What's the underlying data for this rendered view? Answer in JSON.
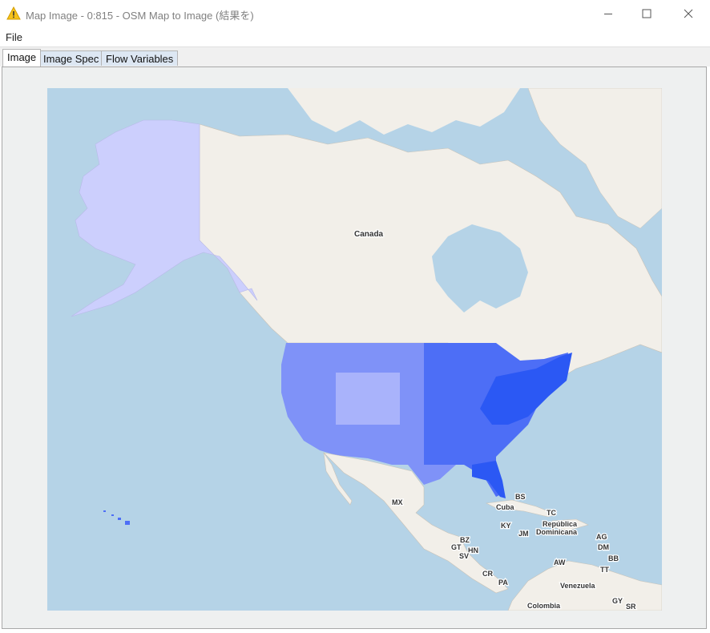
{
  "window": {
    "title": "Map Image - 0:815 - OSM Map to Image (結果を)",
    "icon": "warning-triangle-icon",
    "controls": [
      "minimize-icon",
      "maximize-icon",
      "close-icon"
    ]
  },
  "menu": {
    "items": [
      "File"
    ]
  },
  "tabs": [
    {
      "label": "Image",
      "active": true
    },
    {
      "label": "Image Spec",
      "active": false
    },
    {
      "label": "Flow Variables",
      "active": false
    }
  ],
  "map": {
    "labels": {
      "canada": "Canada",
      "mx": "MX",
      "bs": "BS",
      "cuba": "Cuba",
      "tc": "TC",
      "dr1": "República",
      "dr2": "Dominicana",
      "ky": "KY",
      "jm": "JM",
      "ag": "AG",
      "dm": "DM",
      "bb": "BB",
      "bz": "BZ",
      "gt": "GT",
      "hn": "HN",
      "sv": "SV",
      "cr": "CR",
      "pa": "PA",
      "aw": "AW",
      "tt": "TT",
      "venezuela": "Venezuela",
      "colombia": "Colombia",
      "gy": "GY",
      "sr": "SR"
    },
    "colors": {
      "ocean": "#b5d3e7",
      "land": "#f2efe9",
      "alaska": "#cccffd",
      "us_light": "#a9b3fb",
      "us_mid": "#7f92f8",
      "us_dark": "#4d6ef6",
      "us_darkest": "#2b58f4"
    }
  }
}
